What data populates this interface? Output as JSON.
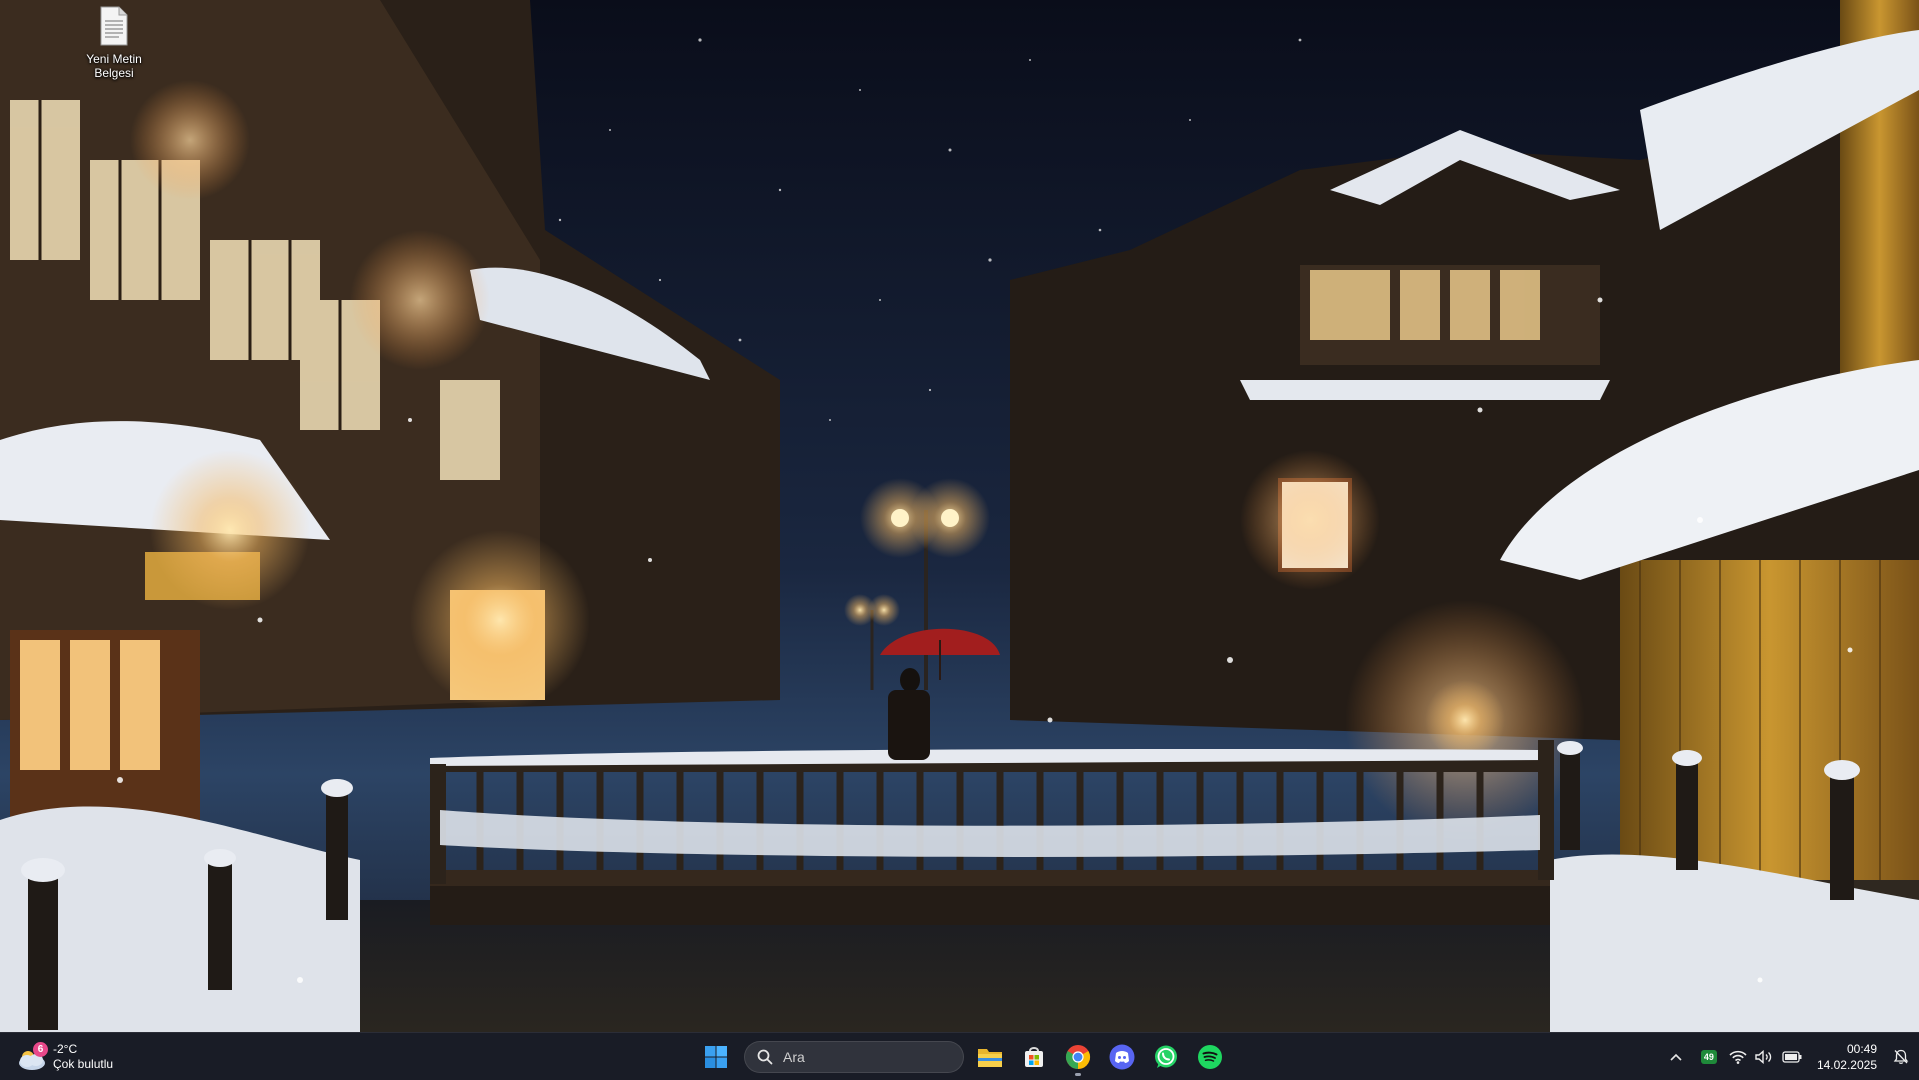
{
  "desktop": {
    "icons": [
      {
        "label": "Yeni Metin Belgesi",
        "icon": "text-document-icon"
      }
    ]
  },
  "taskbar": {
    "weather": {
      "temperature": "-2°C",
      "condition": "Çok bulutlu",
      "badge": "6",
      "icon": "cloudy-weather-icon"
    },
    "start_icon": "windows-start-icon",
    "search": {
      "placeholder": "Ara",
      "value": ""
    },
    "pinned_apps": [
      {
        "name": "File Explorer",
        "icon": "folder-icon"
      },
      {
        "name": "Microsoft Store",
        "icon": "store-icon"
      },
      {
        "name": "Google Chrome",
        "icon": "chrome-icon"
      },
      {
        "name": "Discord",
        "icon": "discord-icon"
      },
      {
        "name": "WhatsApp",
        "icon": "whatsapp-icon"
      },
      {
        "name": "Spotify",
        "icon": "spotify-icon"
      }
    ],
    "tray": {
      "overflow_icon": "chevron-up-icon",
      "app_badge": "49",
      "wifi_icon": "wifi-icon",
      "volume_icon": "speaker-icon",
      "battery_icon": "battery-icon",
      "time": "00:49",
      "date": "14.02.2025",
      "notification_icon": "notification-bell-icon"
    }
  },
  "colors": {
    "taskbar_bg": "#1c1e28",
    "start_blue": "#3aa0f0",
    "chrome_red": "#ea4335",
    "discord": "#5865f2",
    "whatsapp": "#25d366",
    "spotify": "#1ed760",
    "weather_badge": "#e8488a"
  }
}
